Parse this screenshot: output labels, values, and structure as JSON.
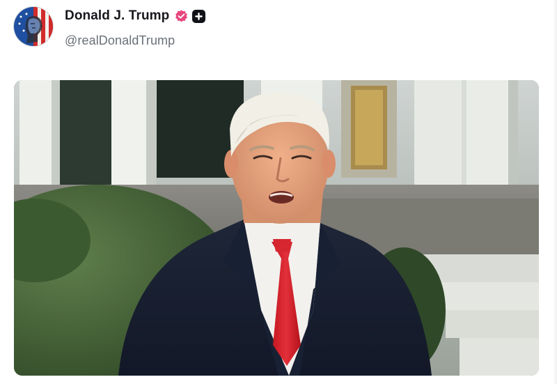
{
  "post": {
    "author": {
      "display_name": "Donald J. Trump",
      "handle": "@realDonaldTrump",
      "avatar_icon": "flag-portrait-avatar",
      "verified_icon": "verified-badge-icon",
      "verified_color": "#e8467c",
      "plus_icon": "plus-badge-icon"
    },
    "media": {
      "type": "video-still",
      "scene": "man-in-dark-coat-red-tie-outdoors-colonnade"
    }
  },
  "colors": {
    "name_text": "#17181c",
    "handle_text": "#6a6f78",
    "background": "#ffffff"
  }
}
